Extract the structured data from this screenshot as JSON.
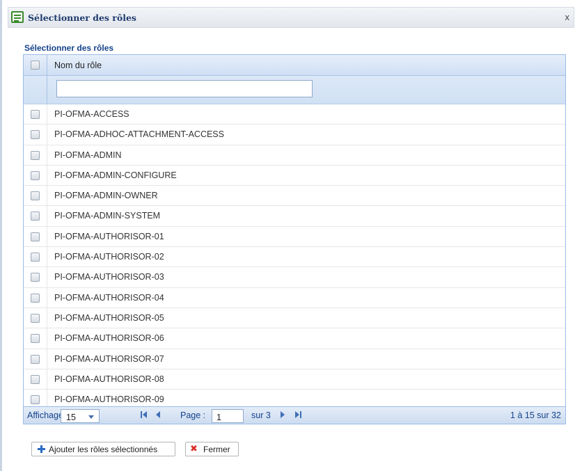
{
  "dialog": {
    "title": "Sélectionner des rôles",
    "close_label": "x"
  },
  "panel": {
    "title": "Sélectionner des rôles"
  },
  "grid": {
    "column_header": "Nom du rôle",
    "filter_value": "",
    "rows": [
      "PI-OFMA-ACCESS",
      "PI-OFMA-ADHOC-ATTACHMENT-ACCESS",
      "PI-OFMA-ADMIN",
      "PI-OFMA-ADMIN-CONFIGURE",
      "PI-OFMA-ADMIN-OWNER",
      "PI-OFMA-ADMIN-SYSTEM",
      "PI-OFMA-AUTHORISOR-01",
      "PI-OFMA-AUTHORISOR-02",
      "PI-OFMA-AUTHORISOR-03",
      "PI-OFMA-AUTHORISOR-04",
      "PI-OFMA-AUTHORISOR-05",
      "PI-OFMA-AUTHORISOR-06",
      "PI-OFMA-AUTHORISOR-07",
      "PI-OFMA-AUTHORISOR-08",
      "PI-OFMA-AUTHORISOR-09"
    ]
  },
  "pager": {
    "affichage_label": "Affichage :",
    "page_size": "15",
    "page_label": "Page :",
    "page_value": "1",
    "of_total": "sur 3",
    "summary": "1 à 15 sur 32"
  },
  "buttons": {
    "add_label": "Ajouter les rôles sélectionnés",
    "close_label": "Fermer"
  },
  "colors": {
    "accent": "#15428b",
    "header_bg": "#d6e4f5",
    "close_icon": "#d9322b",
    "add_icon": "#2a6ac2"
  }
}
